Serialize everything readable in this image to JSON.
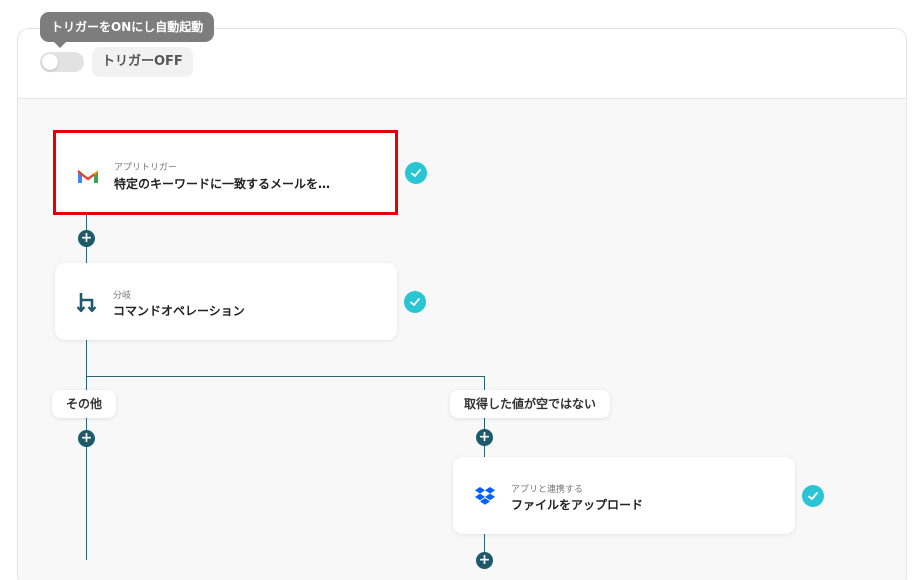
{
  "header": {
    "tooltip": "トリガーをONにし自動起動",
    "toggle_label": "トリガーOFF"
  },
  "flow": {
    "trigger": {
      "subtitle": "アプリトリガー",
      "title": "特定のキーワードに一致するメールを…",
      "icon": "gmail-icon"
    },
    "branch": {
      "subtitle": "分岐",
      "title": "コマンドオペレーション",
      "icon": "branch-icon"
    },
    "branches": {
      "left_label": "その他",
      "right_label": "取得した値が空ではない"
    },
    "upload": {
      "subtitle": "アプリと連携する",
      "title": "ファイルをアップロード",
      "icon": "dropbox-icon"
    }
  },
  "colors": {
    "highlight": "#e60000",
    "check": "#29c5d4",
    "connector": "#2a6378",
    "plus": "#1e5a6e"
  }
}
